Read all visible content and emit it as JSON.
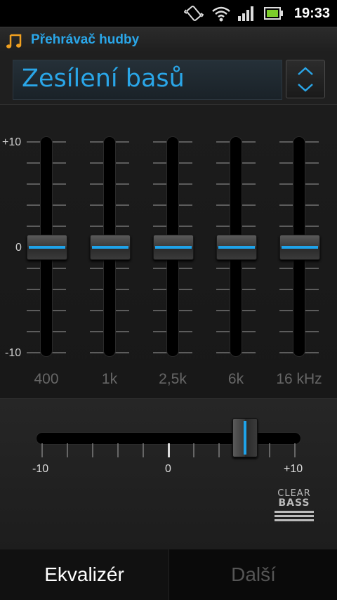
{
  "status": {
    "time": "19:33"
  },
  "app": {
    "title": "Přehrávač hudby",
    "icon": "music-note-icon"
  },
  "preset": {
    "value": "Zesílení basů"
  },
  "equalizer": {
    "scale_max": "+10",
    "scale_mid": "0",
    "scale_min": "-10",
    "bands": [
      {
        "freq": "400",
        "value": 0
      },
      {
        "freq": "1k",
        "value": 0
      },
      {
        "freq": "2,5k",
        "value": 0
      },
      {
        "freq": "6k",
        "value": 0
      },
      {
        "freq": "16 kHz",
        "value": 0
      }
    ]
  },
  "clear_bass": {
    "min_label": "-10",
    "mid_label": "0",
    "max_label": "+10",
    "value": 6,
    "logo_line1": "CLEAR",
    "logo_line2": "BASS"
  },
  "tabs": {
    "equalizer": "Ekvalizér",
    "more": "Další"
  },
  "colors": {
    "accent": "#1ea3ea"
  }
}
